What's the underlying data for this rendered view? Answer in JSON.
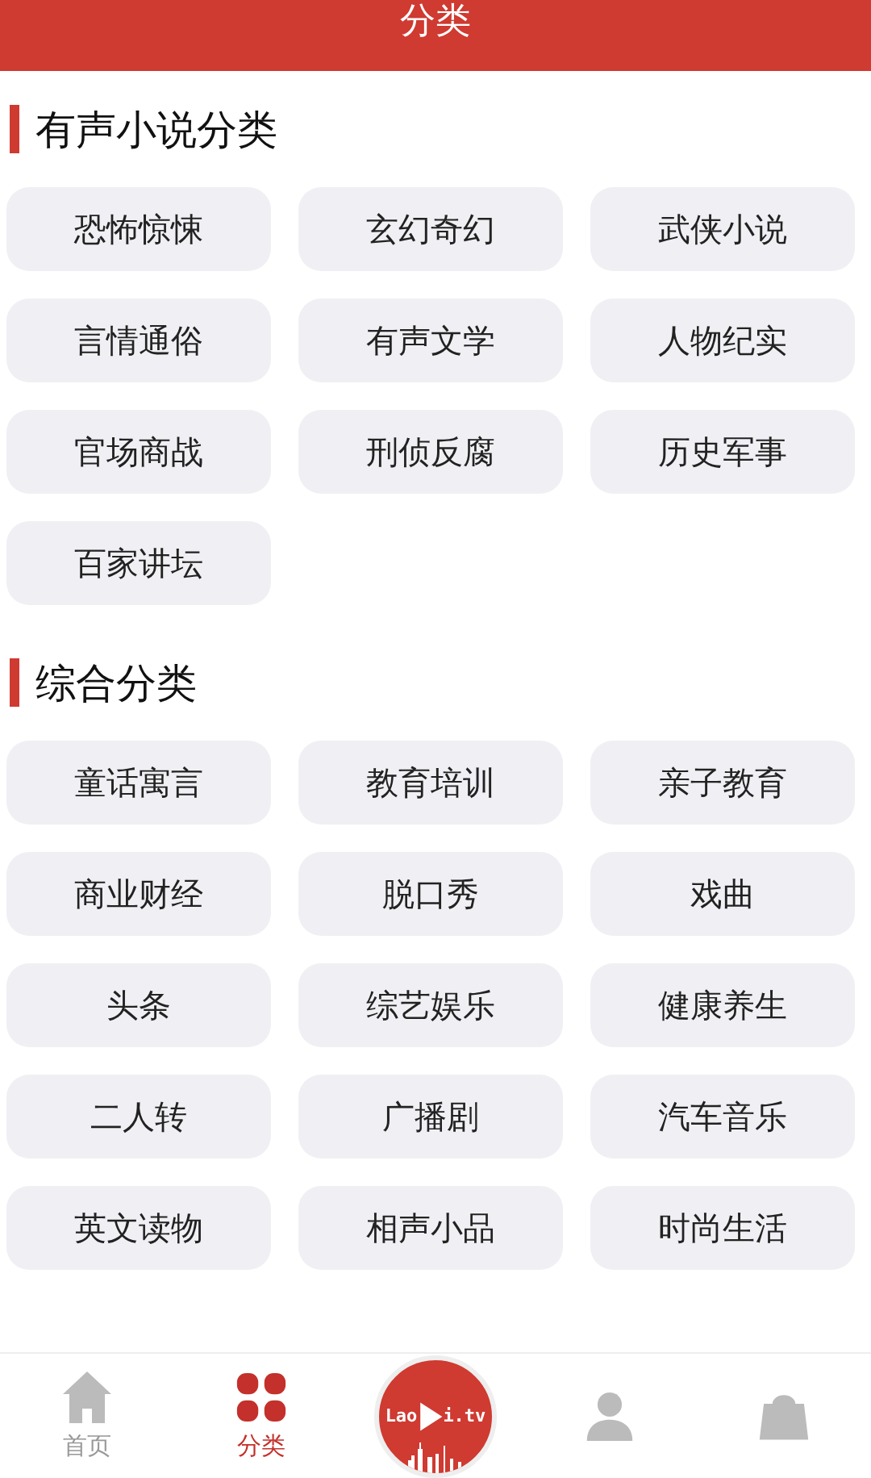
{
  "header": {
    "title": "分类"
  },
  "sections": [
    {
      "title": "有声小说分类",
      "items": [
        "恐怖惊悚",
        "玄幻奇幻",
        "武侠小说",
        "言情通俗",
        "有声文学",
        "人物纪实",
        "官场商战",
        "刑侦反腐",
        "历史军事",
        "百家讲坛"
      ]
    },
    {
      "title": "综合分类",
      "items": [
        "童话寓言",
        "教育培训",
        "亲子教育",
        "商业财经",
        "脱口秀",
        "戏曲",
        "头条",
        "综艺娱乐",
        "健康养生",
        "二人转",
        "广播剧",
        "汽车音乐",
        "英文读物",
        "相声小品",
        "时尚生活"
      ]
    }
  ],
  "tab_bar": [
    {
      "kind": "home",
      "label": "首页",
      "selected": false
    },
    {
      "kind": "category",
      "label": "分类",
      "selected": true
    },
    {
      "kind": "center",
      "logo_left": "Lao",
      "logo_right": "i.tv"
    },
    {
      "kind": "person"
    },
    {
      "kind": "shop"
    }
  ]
}
